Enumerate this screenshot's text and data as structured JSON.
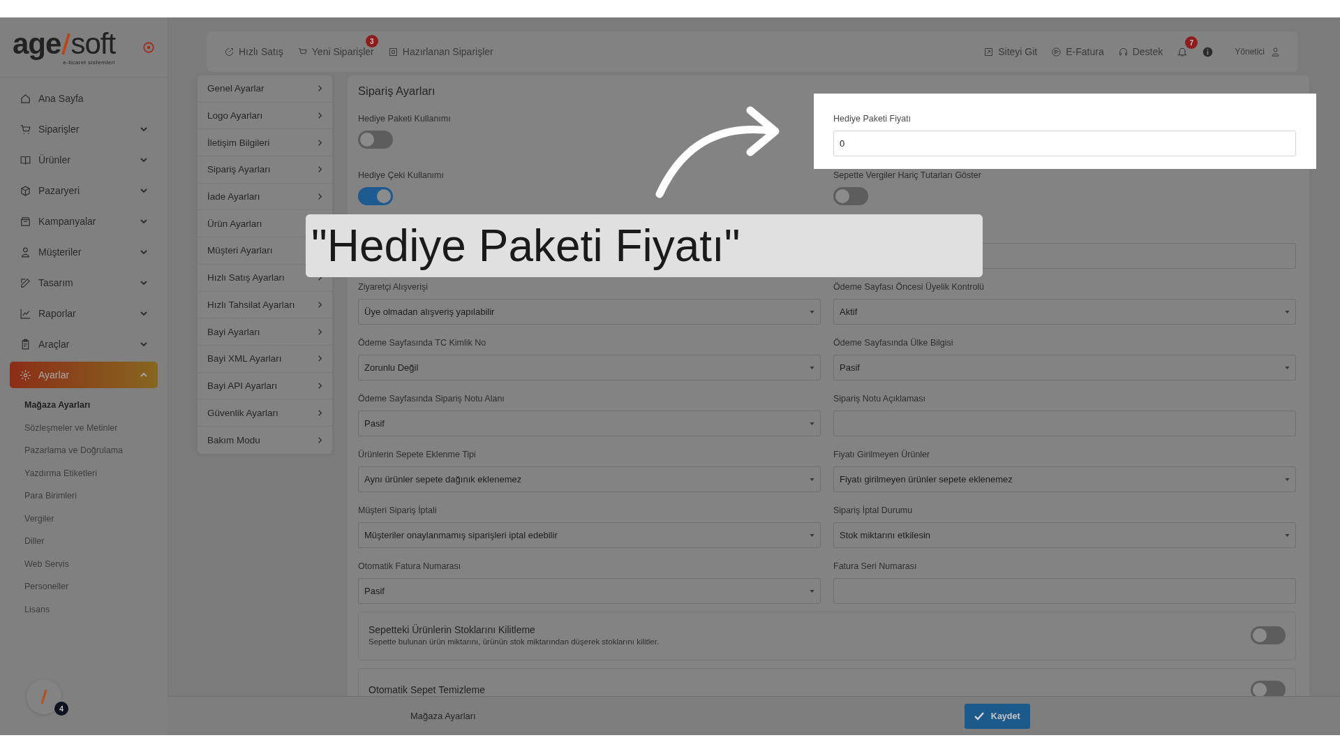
{
  "sidebar": {
    "logo": {
      "left": "age",
      "right": "soft",
      "tagline": "e-ticaret sistemleri"
    },
    "items": [
      {
        "label": "Ana Sayfa",
        "kind": "link",
        "expanded": false
      },
      {
        "label": "Siparişler",
        "kind": "group",
        "expanded": false
      },
      {
        "label": "Ürünler",
        "kind": "group",
        "expanded": false
      },
      {
        "label": "Pazaryeri",
        "kind": "group",
        "expanded": false
      },
      {
        "label": "Kampanyalar",
        "kind": "group",
        "expanded": false
      },
      {
        "label": "Müşteriler",
        "kind": "group",
        "expanded": false
      },
      {
        "label": "Tasarım",
        "kind": "group",
        "expanded": false
      },
      {
        "label": "Raporlar",
        "kind": "group",
        "expanded": false
      },
      {
        "label": "Araçlar",
        "kind": "group",
        "expanded": false
      },
      {
        "label": "Ayarlar",
        "kind": "group",
        "expanded": true
      }
    ],
    "subitems": [
      {
        "label": "Mağaza Ayarları",
        "selected": true
      },
      {
        "label": "Sözleşmeler ve Metinler",
        "selected": false
      },
      {
        "label": "Pazarlama ve Doğrulama",
        "selected": false
      },
      {
        "label": "Yazdırma Etiketleri",
        "selected": false
      },
      {
        "label": "Para Birimleri",
        "selected": false
      },
      {
        "label": "Vergiler",
        "selected": false
      },
      {
        "label": "Diller",
        "selected": false
      },
      {
        "label": "Web Servis",
        "selected": false
      },
      {
        "label": "Personeller",
        "selected": false
      },
      {
        "label": "Lisans",
        "selected": false
      }
    ],
    "assistant_badge": "4"
  },
  "header": {
    "left": [
      {
        "label": "Hızlı Satış"
      },
      {
        "label": "Yeni Siparişler",
        "badge": "3"
      },
      {
        "label": "Hazırlanan Siparişler"
      }
    ],
    "right": [
      {
        "label": "Siteyi Git"
      },
      {
        "label": "E-Fatura"
      },
      {
        "label": "Destek"
      }
    ],
    "notifications": "7",
    "user": "Yönetici"
  },
  "settings_menu": [
    "Genel Ayarlar",
    "Logo Ayarları",
    "İletişim Bilgileri",
    "Sipariş Ayarları",
    "İade Ayarları",
    "Ürün Ayarları",
    "Müşteri Ayarları",
    "Hızlı Satış Ayarları",
    "Hızlı Tahsilat Ayarları",
    "Bayi Ayarları",
    "Bayi XML Ayarları",
    "Bayi API Ayarları",
    "Güvenlik Ayarları",
    "Bakım Modu"
  ],
  "form": {
    "title": "Sipariş Ayarları",
    "fields": [
      {
        "kind": "toggle",
        "label": "Hediye Paketi Kullanımı",
        "on": false,
        "highlight": false
      },
      {
        "kind": "input",
        "label": "Hediye Paketi Fiyatı",
        "value": "0",
        "highlight": true
      },
      {
        "kind": "toggle",
        "label": "Hediye Çeki Kullanımı",
        "on": true,
        "highlight": false
      },
      {
        "kind": "toggle",
        "label": "Sepette Vergiler Hariç Tutarları Göster",
        "on": false,
        "highlight": false
      },
      {
        "kind": "wide-input",
        "highlight": false
      },
      {
        "kind": "select",
        "label": "Ziyaretçi Alışverişi",
        "value": "Üye olmadan alışveriş yapılabilir",
        "highlight": false
      },
      {
        "kind": "select",
        "label": "Ödeme Sayfası Öncesi Üyelik Kontrolü",
        "value": "Aktif",
        "highlight": false
      },
      {
        "kind": "select",
        "label": "Ödeme Sayfasında TC Kimlik No",
        "value": "Zorunlu Değil",
        "highlight": false
      },
      {
        "kind": "select",
        "label": "Ödeme Sayfasında Ülke Bilgisi",
        "value": "Pasif",
        "highlight": false
      },
      {
        "kind": "select",
        "label": "Ödeme Sayfasında Sipariş Notu Alanı",
        "value": "Pasif",
        "highlight": false
      },
      {
        "kind": "input",
        "label": "Sipariş Notu Açıklaması",
        "highlight": false
      },
      {
        "kind": "select",
        "label": "Ürünlerin Sepete Eklenme Tipi",
        "value": "Aynı ürünler sepete dağınık eklenemez",
        "highlight": false
      },
      {
        "kind": "select",
        "label": "Fiyatı Girilmeyen Ürünler",
        "value": "Fiyatı girilmeyen ürünler sepete eklenemez",
        "highlight": false
      },
      {
        "kind": "select",
        "label": "Müşteri Sipariş İptali",
        "value": "Müşteriler onaylanmamış siparişleri iptal edebilir",
        "highlight": false
      },
      {
        "kind": "select",
        "label": "Sipariş İptal Durumu",
        "value": "Stok miktarını etkilesin",
        "highlight": false
      },
      {
        "kind": "select",
        "label": "Otomatik Fatura Numarası",
        "value": "Pasif",
        "highlight": false
      },
      {
        "kind": "input",
        "label": "Fatura Seri Numarası",
        "highlight": false
      }
    ],
    "cards": [
      {
        "title": "Sepetteki Ürünlerin Stoklarını Kilitleme",
        "description": "Sepette bulunan ürün miktarını, ürünün stok miktarından düşerek stoklarını kilitler.",
        "on": false
      },
      {
        "title": "Otomatik Sepet Temizleme",
        "on": false
      }
    ]
  },
  "footer": {
    "breadcrumb": "Mağaza Ayarları",
    "save": "Kaydet"
  },
  "annotation": {
    "caption": "\"Hediye Paketi Fiyatı\""
  }
}
